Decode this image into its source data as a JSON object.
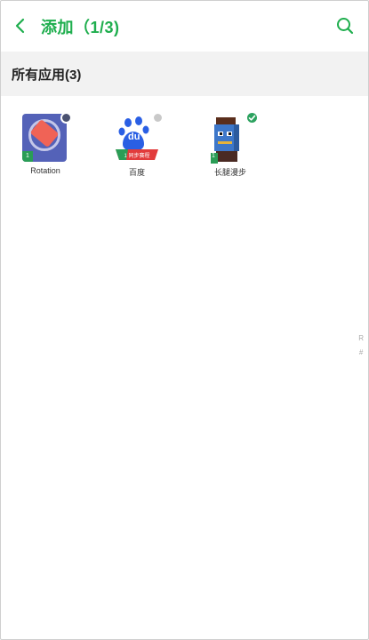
{
  "header": {
    "title": "添加（1/3)",
    "back_icon": "chevron-left-icon",
    "search_icon": "search-icon",
    "accent_color": "#1fae4e"
  },
  "section": {
    "title": "所有应用(3)"
  },
  "apps": [
    {
      "label": "Rotation",
      "icon": "rotation-app-icon",
      "status": "unselected",
      "badge": "1"
    },
    {
      "label": "百度",
      "icon": "baidu-app-icon",
      "status": "unselected",
      "badge_text": "1 同步赛程"
    },
    {
      "label": "长腿漫步",
      "icon": "pixel-character-app-icon",
      "status": "selected",
      "badge": "1"
    }
  ],
  "edge_marks": [
    "R",
    "#"
  ]
}
